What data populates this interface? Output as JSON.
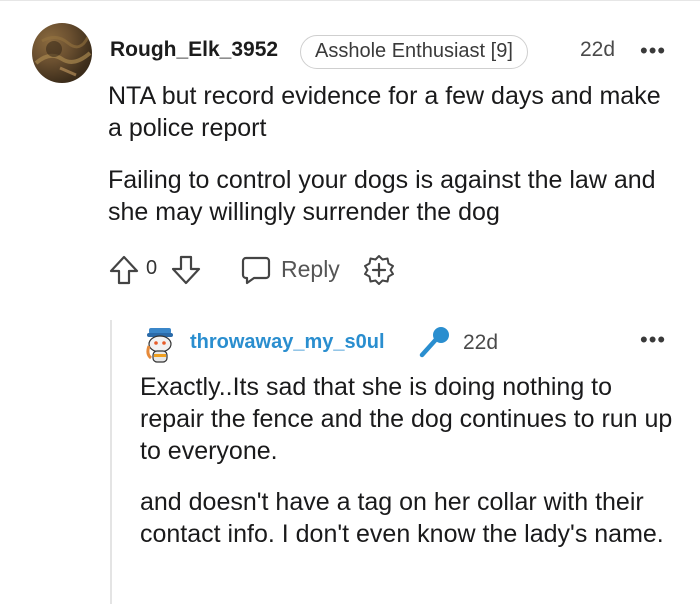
{
  "comment": {
    "username": "Rough_Elk_3952",
    "flair": "Asshole Enthusiast [9]",
    "time": "22d",
    "more": "•••",
    "paragraphs": [
      "NTA but record evidence for a few days and make a police report",
      "Failing to control your dogs is against the law and she may willingly surrender the dog"
    ],
    "votes": "0",
    "reply_label": "Reply",
    "icons": [
      "avatar",
      "upvote-icon",
      "downvote-icon",
      "reply-icon",
      "award-icon",
      "more-icon"
    ]
  },
  "reply": {
    "username": "throwaway_my_s0ul",
    "time": "22d",
    "more": "•••",
    "paragraphs": [
      "Exactly..Its sad that she is doing nothing to repair the fence and the dog continues to run up to everyone.",
      "and doesn't have a tag on her collar with their contact info. I don't even know the lady's name."
    ],
    "icons": [
      "snoo-avatar",
      "microphone-icon",
      "more-icon"
    ]
  },
  "colors": {
    "username_reply": "#2a8ecf",
    "mic": "#2a8ecf",
    "text": "#1a1a1b",
    "muted": "#4a4a4a"
  }
}
